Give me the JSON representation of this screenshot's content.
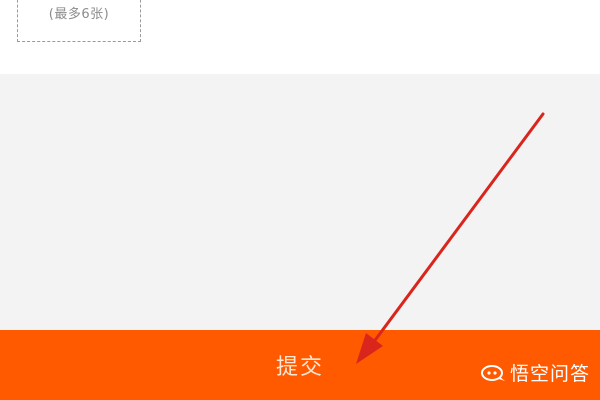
{
  "upload": {
    "hint": "(最多6张)"
  },
  "submit_bar": {
    "label": "提交"
  },
  "watermark": {
    "text": "悟空问答"
  },
  "colors": {
    "accent": "#ff5a00",
    "gray_area": "#f3f3f3",
    "arrow": "#d9251c"
  },
  "icons": {
    "annotation": "arrow-annotation",
    "watermark": "speech-bubble-icon"
  }
}
